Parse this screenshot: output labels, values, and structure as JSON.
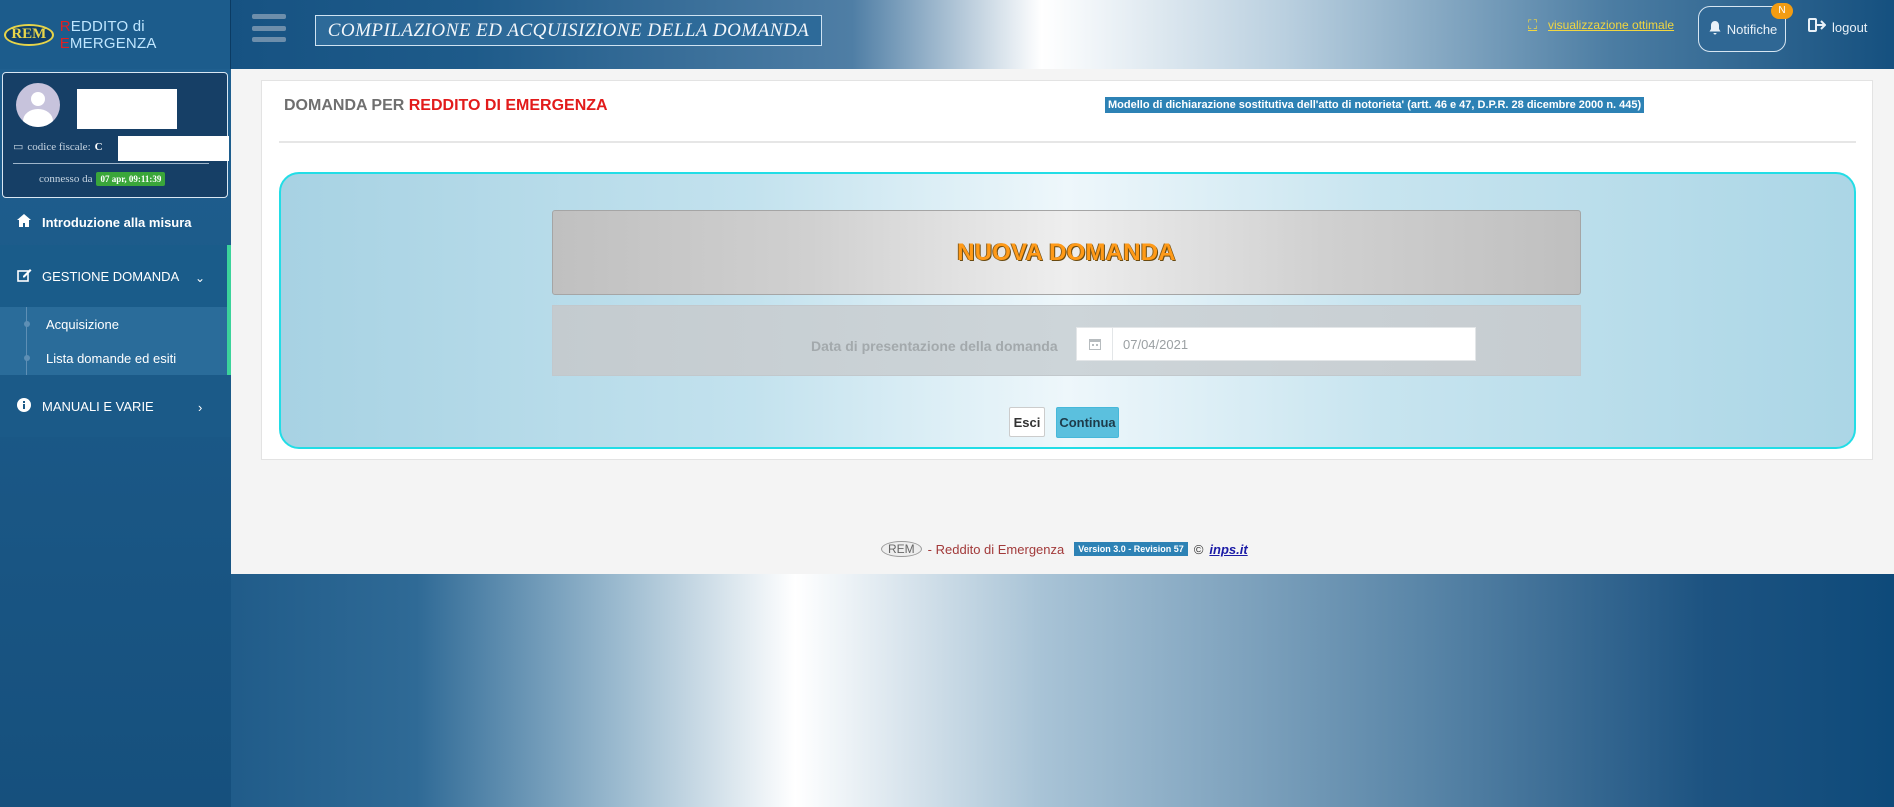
{
  "header": {
    "logo_text": "REM",
    "brand_r": "R",
    "brand_eddito": "EDDITO di ",
    "brand_e": "E",
    "brand_mergenza": "MERGENZA",
    "title": "COMPILAZIONE ED ACQUISIZIONE DELLA DOMANDA",
    "vis_ottimale": "visualizzazione ottimale",
    "notifications_label": "Notifiche",
    "notifications_badge": "N",
    "logout_label": "logout"
  },
  "user": {
    "cf_label": "codice fiscale:",
    "cf_value_visible": "C",
    "connected_label": "connesso da",
    "connected_since": "07 apr, 09:11:39"
  },
  "sidebar": {
    "intro": "Introduzione alla misura",
    "gestione": "GESTIONE DOMANDA",
    "sub_items": [
      "Acquisizione",
      "Lista domande ed esiti"
    ],
    "manuali": "MANUALI E VARIE"
  },
  "main": {
    "title_prefix": "DOMANDA PER ",
    "title_red": "REDDITO DI EMERGENZA",
    "modello_badge": "Modello di dichiarazione sostitutiva dell'atto di notorieta' (artt. 46 e 47, D.P.R. 28 dicembre 2000 n. 445)",
    "nuova_domanda": "NUOVA DOMANDA",
    "data_label": "Data di presentazione della domanda",
    "data_value": "07/04/2021",
    "esci_label": "Esci",
    "continua_label": "Continua"
  },
  "footer": {
    "logo_text": "REM",
    "app_name": "- Reddito di Emergenza",
    "version": "Version 3.0 - Revision 57",
    "copyright": "©",
    "link": "inps.it"
  },
  "colors": {
    "accent_red": "#e21b1b",
    "button_info": "#5bc0de",
    "badge_blue": "#2d82b5",
    "wizard_border": "#22dde6",
    "nuova_orange": "#ff9a18"
  },
  "icons": {
    "menu": "hamburger-icon",
    "binoculars": "binoculars-icon",
    "bell": "bell-icon",
    "logout": "logout-icon",
    "card": "id-card-icon",
    "home": "home-icon",
    "edit": "edit-icon",
    "info": "info-icon",
    "calendar": "calendar-icon"
  }
}
